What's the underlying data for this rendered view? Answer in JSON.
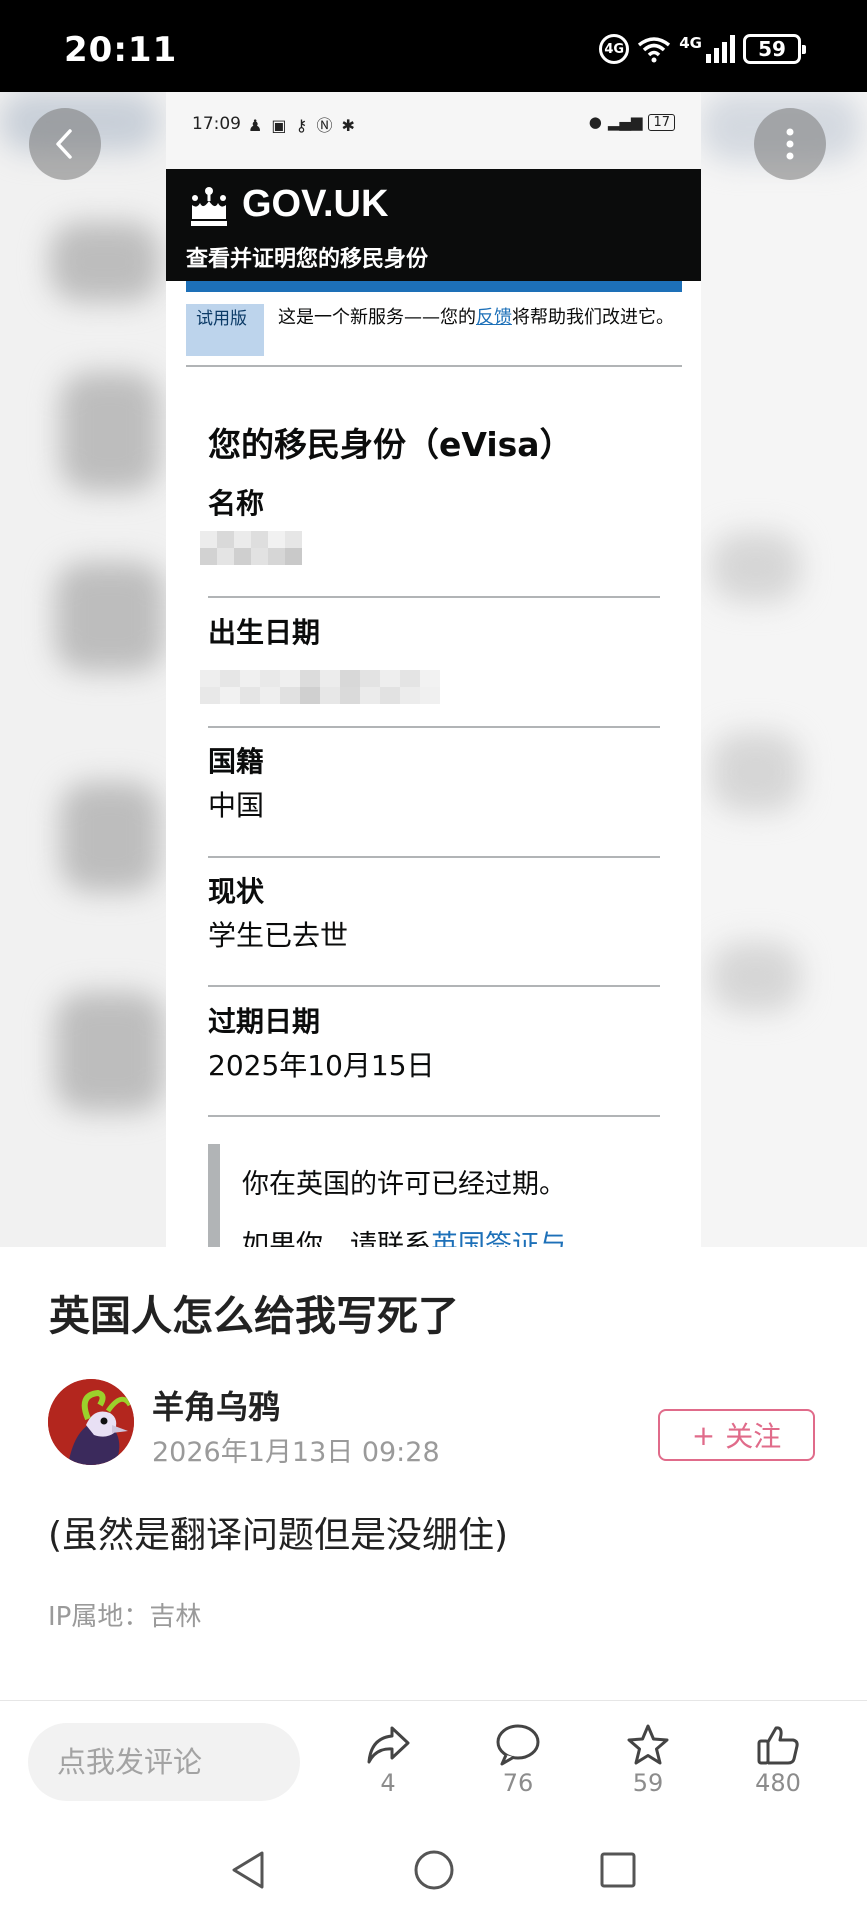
{
  "status_bar": {
    "time": "20:11",
    "data_speed_icon": "4G",
    "signal_label": "4G",
    "battery": "59"
  },
  "screenshot": {
    "status_time": "17:09",
    "status_battery": "17",
    "gov_logo": "GOV.UK",
    "service_name": "查看并证明您的移民身份",
    "beta_tag": "试用版",
    "beta_text_before": "这是一个新服务——您的",
    "beta_link": "反馈",
    "beta_text_after": "将帮助我们改进它。",
    "heading": "您的移民身份（eVisa）",
    "fields": [
      {
        "label": "名称",
        "value": ""
      },
      {
        "label": "出生日期",
        "value": ""
      },
      {
        "label": "国籍",
        "value": "中国"
      },
      {
        "label": "现状",
        "value": "学生已去世"
      },
      {
        "label": "过期日期",
        "value": "2025年10月15日"
      }
    ],
    "inset_line1": "你在英国的许可已经过期。",
    "inset_line2_before": "如果你，请联系",
    "inset_line2_link": "英国签证与"
  },
  "post": {
    "title": "英国人怎么给我写死了",
    "author": "羊角乌鸦",
    "date": "2026年1月13日 09:28",
    "follow_icon": "+",
    "follow_label": "关注",
    "body": "(虽然是翻译问题但是没绷住)",
    "ip": "IP属地：吉林"
  },
  "bottom_bar": {
    "comment_placeholder": "点我发评论",
    "share_count": "4",
    "comment_count": "76",
    "favorite_count": "59",
    "like_count": "480"
  },
  "colors": {
    "gov_black": "#0b0c0c",
    "gov_blue": "#1d70b8",
    "follow_pink": "#e06b8a"
  },
  "icons": [
    "back-icon",
    "more-icon",
    "share-icon",
    "comment-icon",
    "star-icon",
    "thumb-up-icon",
    "nav-back-icon",
    "nav-home-icon",
    "nav-recents-icon",
    "crown-icon"
  ]
}
